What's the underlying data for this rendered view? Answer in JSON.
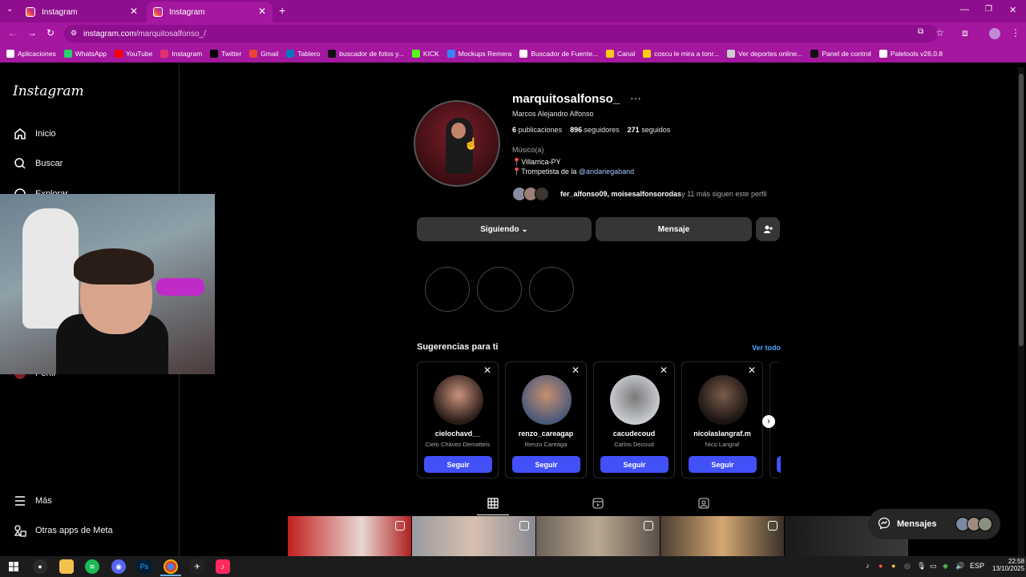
{
  "browser": {
    "tabs": [
      {
        "label": "Instagram"
      },
      {
        "label": "Instagram"
      }
    ],
    "url_host": "instagram.com",
    "url_path": "/marquitosalfonso_/",
    "bookmarks": [
      {
        "label": "Aplicaciones",
        "icon": "grid-icon",
        "color": "#ffffff"
      },
      {
        "label": "WhatsApp",
        "icon": "whatsapp-icon",
        "color": "#25d366"
      },
      {
        "label": "YouTube",
        "icon": "youtube-icon",
        "color": "#ff0000"
      },
      {
        "label": "Instagram",
        "icon": "instagram-icon",
        "color": "#e1306c"
      },
      {
        "label": "Twitter",
        "icon": "x-icon",
        "color": "#000000"
      },
      {
        "label": "Gmail",
        "icon": "gmail-icon",
        "color": "#ea4335"
      },
      {
        "label": "Tablero",
        "icon": "trello-icon",
        "color": "#0079bf"
      },
      {
        "label": "buscador de fotos y...",
        "icon": "photo-search-icon",
        "color": "#111111"
      },
      {
        "label": "KICK",
        "icon": "kick-icon",
        "color": "#53fc18"
      },
      {
        "label": "Mockups Remera",
        "icon": "shirt-icon",
        "color": "#3b82f6"
      },
      {
        "label": "Buscador de Fuente...",
        "icon": "font-icon",
        "color": "#ffffff"
      },
      {
        "label": "Canal",
        "icon": "doc-icon",
        "color": "#facc15"
      },
      {
        "label": "coscu le mira a tonr...",
        "icon": "doc-icon",
        "color": "#facc15"
      },
      {
        "label": "Ver deportes online...",
        "icon": "globe-icon",
        "color": "#cccccc"
      },
      {
        "label": "Panel de control",
        "icon": "panel-icon",
        "color": "#111111"
      },
      {
        "label": "Paletools v26.0.8",
        "icon": "palette-icon",
        "color": "#ffffff"
      }
    ]
  },
  "sidebar": {
    "logo": "Instagram",
    "items": [
      {
        "label": "Inicio"
      },
      {
        "label": "Buscar"
      },
      {
        "label": "Explorar"
      },
      {
        "label": "Perfil"
      },
      {
        "label": "Más"
      },
      {
        "label": "Otras apps de Meta"
      }
    ]
  },
  "profile": {
    "username": "marquitosalfonso_",
    "full_name": "Marcos Alejandro Alfonso",
    "posts_count": "6",
    "posts_label": "publicaciones",
    "followers_count": "896",
    "followers_label": "seguidores",
    "following_count": "271",
    "following_label": "seguidos",
    "category": "Músico(a)",
    "bio_line1": "Villarrica-PY",
    "bio_line2_prefix": "Trompetista de la ",
    "bio_mention": "@andariegaband",
    "followed_by_names": "fer_alfonso09, moisesalfonsorodas",
    "followed_by_suffix": " y 11 más siguen este perfil",
    "following_button": "Siguiendo",
    "message_button": "Mensaje"
  },
  "suggestions": {
    "title": "Sugerencias para ti",
    "see_all": "Ver todo",
    "follow_label": "Seguir",
    "cards": [
      {
        "username": "cielochavd__",
        "name": "Cielo Chávez Dematteis"
      },
      {
        "username": "renzo_careagap",
        "name": "Renzo Careaga"
      },
      {
        "username": "cacudecoud",
        "name": "Carlos Decoud"
      },
      {
        "username": "nicolaslangraf.m",
        "name": "Nico Langraf"
      }
    ]
  },
  "messages": {
    "label": "Mensajes"
  },
  "taskbar": {
    "language": "ESP",
    "time": "22:58",
    "date": "13/10/2025"
  },
  "colors": {
    "browser_chrome": "#a5179f",
    "follow_blue": "#4150f7",
    "instagram_bg": "#000000"
  }
}
